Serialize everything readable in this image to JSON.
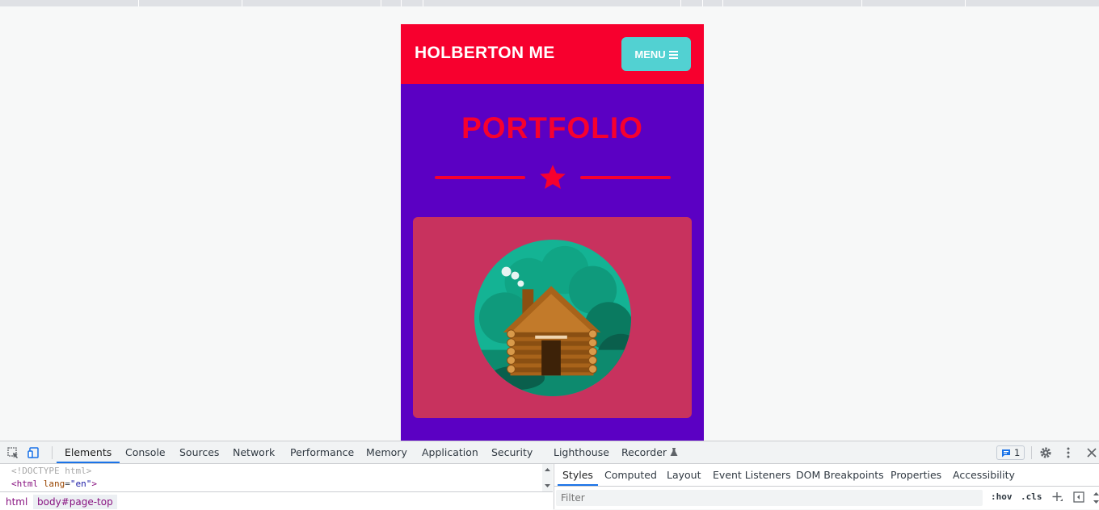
{
  "site": {
    "brand": "HOLBERTON ME",
    "menu_label": "MENU",
    "portfolio_title": "PORTFOLIO",
    "colors": {
      "primary": "#f7002e",
      "background": "#5b00c3",
      "menu_button": "#52d1d2",
      "card": "#c8325e"
    },
    "portfolio_item_icon": "log-cabin-illustration"
  },
  "devtools": {
    "tabs": [
      "Elements",
      "Console",
      "Sources",
      "Network",
      "Performance",
      "Memory",
      "Application",
      "Security",
      "Lighthouse",
      "Recorder"
    ],
    "active_tab": "Elements",
    "issues_count": "1",
    "dom": {
      "doctype": "<!DOCTYPE html>",
      "html_tag": "html",
      "html_attr_name": "lang",
      "html_attr_value": "\"en\""
    },
    "breadcrumbs": [
      "html",
      "body#page-top"
    ],
    "styles_tabs": [
      "Styles",
      "Computed",
      "Layout",
      "Event Listeners",
      "DOM Breakpoints",
      "Properties",
      "Accessibility"
    ],
    "filter_placeholder": "Filter",
    "hov_label": ":hov",
    "cls_label": ".cls"
  }
}
